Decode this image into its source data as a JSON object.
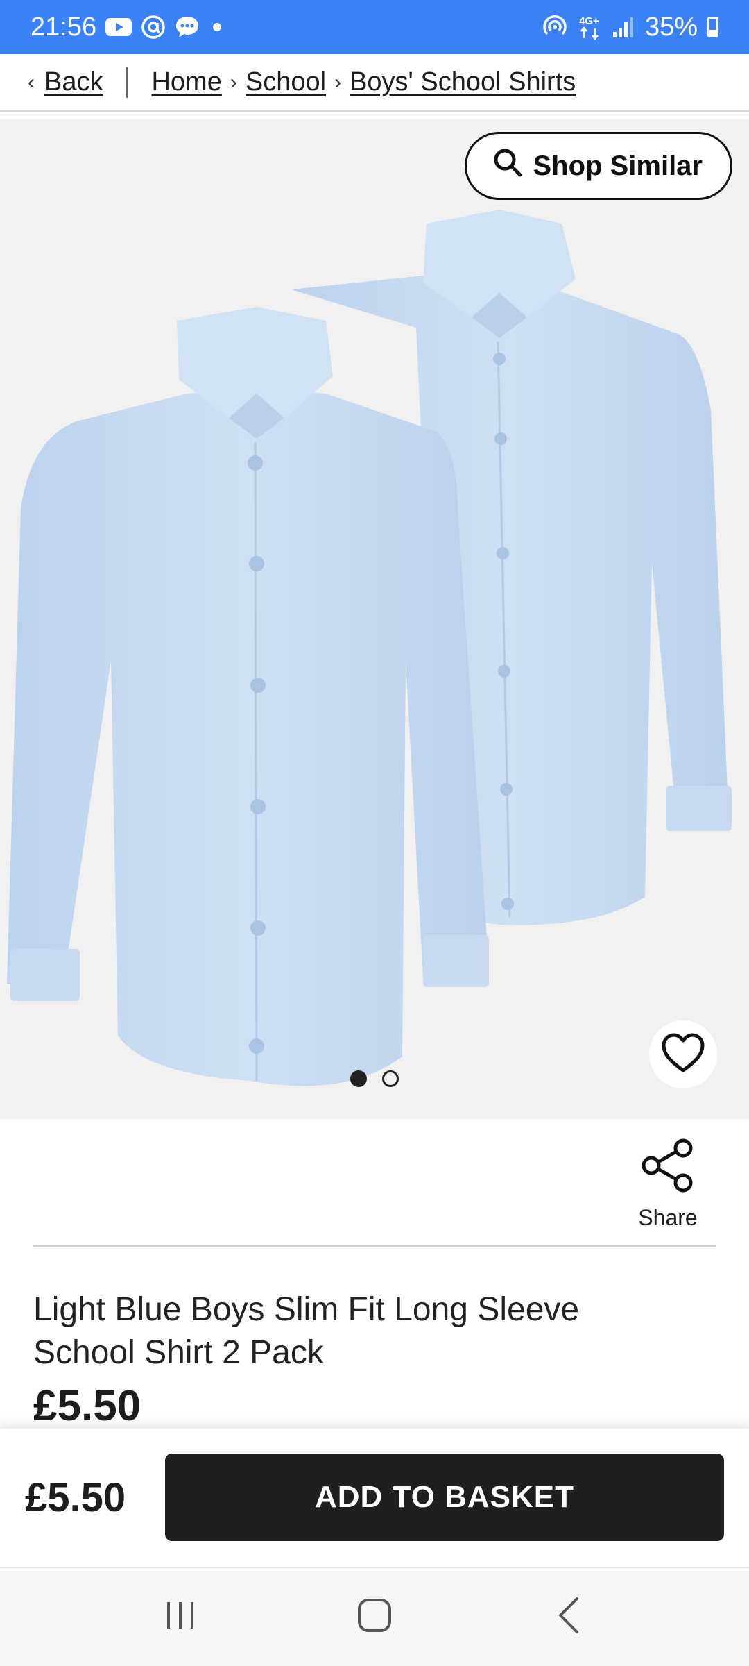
{
  "status_bar": {
    "time": "21:56",
    "battery": "35%",
    "battery_level": 0.35,
    "network": "4G+",
    "icons": [
      "youtube-icon",
      "at-icon",
      "chat-icon",
      "dot-icon",
      "hotspot-icon",
      "network-4g-icon",
      "signal-icon",
      "battery-icon"
    ]
  },
  "breadcrumb": {
    "back": "Back",
    "home": "Home",
    "school": "School",
    "category": "Boys' School Shirts"
  },
  "hero": {
    "shop_similar": "Shop Similar",
    "slide_count": 2,
    "active_slide": 1,
    "shirt_color": "#c9dcf2"
  },
  "share": {
    "label": "Share"
  },
  "product": {
    "title": "Light Blue Boys Slim Fit Long Sleeve School Shirt 2 Pack",
    "price": "£5.50"
  },
  "basket_bar": {
    "price": "£5.50",
    "add_label": "ADD TO BASKET"
  },
  "colors": {
    "status_bar": "#3b82f6",
    "button_dark": "#1f1f1f"
  }
}
